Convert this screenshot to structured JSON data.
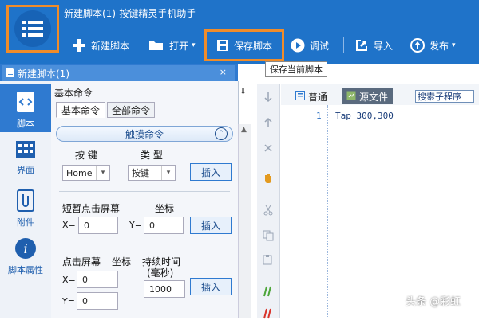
{
  "app": {
    "title": "新建脚本(1)-按键精灵手机助手"
  },
  "toolbar": {
    "new_label": "新建脚本",
    "open_label": "打开",
    "save_label": "保存脚本",
    "debug_label": "调试",
    "import_label": "导入",
    "publish_label": "发布"
  },
  "tooltip": {
    "save": "保存当前脚本"
  },
  "doc_tab": {
    "label": "新建脚本(1)",
    "close": "×"
  },
  "sidebar": {
    "items": [
      {
        "label": "脚本",
        "icon": "script-icon"
      },
      {
        "label": "界面",
        "icon": "ui-grid-icon"
      },
      {
        "label": "附件",
        "icon": "attachment-icon"
      },
      {
        "label": "脚本属性",
        "icon": "info-icon"
      }
    ]
  },
  "commands": {
    "header": "基本命令",
    "pin": "⇓",
    "tabs": [
      "基本命令",
      "全部命令"
    ],
    "section": "触摸命令",
    "key_label": "按 键",
    "type_label": "类 型",
    "key_value": "Home",
    "type_value": "按键",
    "insert": "插入",
    "tap_label": "短暂点击屏幕",
    "coord_label": "坐标",
    "x_label": "X=",
    "y_label": "Y=",
    "tap_x": "0",
    "tap_y": "0",
    "press_label": "点击屏幕",
    "press_coord_label": "坐标",
    "duration_label": "持续时间",
    "duration_unit": "(毫秒)",
    "press_x": "0",
    "press_y": "0",
    "duration_value": "1000"
  },
  "editor": {
    "mode_normal": "普通",
    "mode_source": "源文件",
    "search_placeholder": "搜索子程序",
    "line_number": "1",
    "code": "Tap 300,300"
  },
  "watermark": "头条 @彩虹",
  "colors": {
    "accent": "#1f73c9",
    "highlight": "#f08c2a"
  }
}
